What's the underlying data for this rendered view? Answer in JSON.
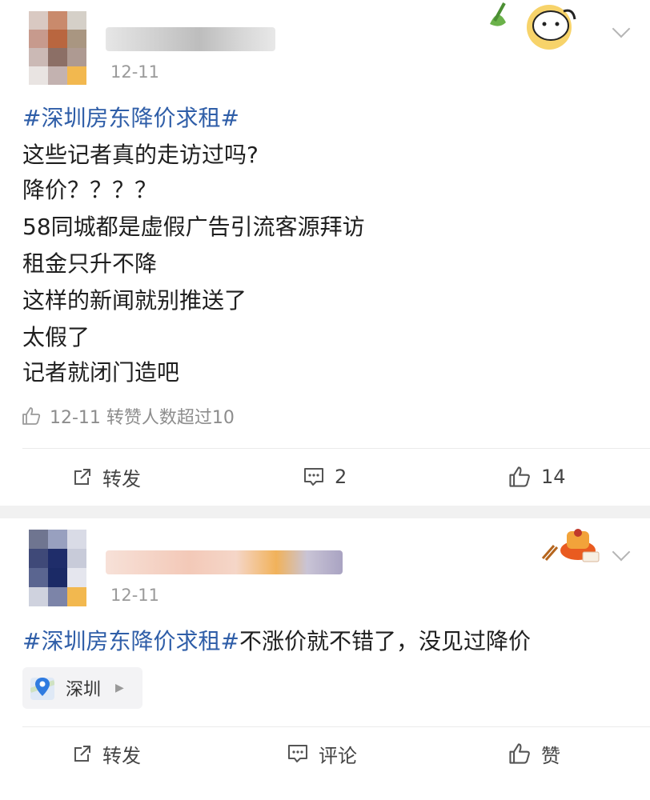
{
  "colors": {
    "topic": "#2f5ea8",
    "text": "#1f1f1f",
    "meta": "#8d8d8d",
    "separator": "#f1f1f1"
  },
  "posts": [
    {
      "time": "12-11",
      "topic": "#深圳房东降价求租#",
      "lines": [
        "这些记者真的走访过吗?",
        "降价？？？？",
        "58同城都是虚假广告引流客源拜访",
        "租金只升不降",
        "这样的新闻就别推送了",
        "太假了",
        "记者就闭门造吧"
      ],
      "meta_text": "12-11 转赞人数超过10",
      "actions": {
        "repost": "转发",
        "comment": "2",
        "like": "14"
      }
    },
    {
      "time": "12-11",
      "topic": "#深圳房东降价求租#",
      "text": "不涨价就不错了，没见过降价",
      "location": "深圳",
      "actions": {
        "repost": "转发",
        "comment": "评论",
        "like": "赞"
      }
    }
  ],
  "icons": [
    "thumb-up-icon",
    "repost-icon",
    "comment-icon",
    "chevron-down-icon",
    "location-pin-icon"
  ]
}
